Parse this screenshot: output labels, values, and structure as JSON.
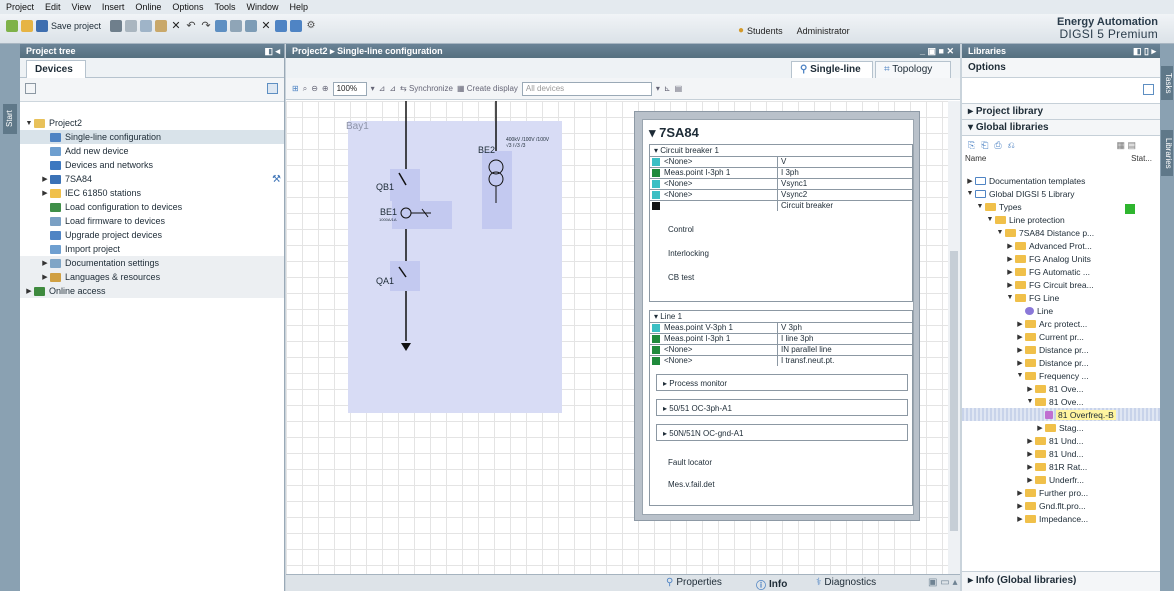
{
  "menu": {
    "items": [
      "Project",
      "Edit",
      "View",
      "Insert",
      "Online",
      "Options",
      "Tools",
      "Window",
      "Help"
    ]
  },
  "toolbar": {
    "save_label": "Save project",
    "user_label": "Students",
    "role_label": "Administrator"
  },
  "brand": {
    "line1": "Energy Automation",
    "line2": "DIGSI 5 Premium"
  },
  "project_tree": {
    "title": "Project tree",
    "tab": "Devices",
    "side_label": "Start",
    "items": [
      {
        "label": "Project2",
        "indent": 0,
        "twisty": "down",
        "icon": "project"
      },
      {
        "label": "Single-line configuration",
        "indent": 1,
        "twisty": "",
        "icon": "sld",
        "selected": true
      },
      {
        "label": "Add new device",
        "indent": 1,
        "twisty": "",
        "icon": "add"
      },
      {
        "label": "Devices and networks",
        "indent": 1,
        "twisty": "",
        "icon": "net"
      },
      {
        "label": "7SA84",
        "indent": 1,
        "twisty": "right",
        "icon": "device"
      },
      {
        "label": "IEC 61850 stations",
        "indent": 1,
        "twisty": "right",
        "icon": "folder"
      },
      {
        "label": "Load configuration to devices",
        "indent": 1,
        "twisty": "",
        "icon": "load"
      },
      {
        "label": "Load firmware to devices",
        "indent": 1,
        "twisty": "",
        "icon": "fw"
      },
      {
        "label": "Upgrade project devices",
        "indent": 1,
        "twisty": "",
        "icon": "upg"
      },
      {
        "label": "Import project",
        "indent": 1,
        "twisty": "",
        "icon": "imp"
      },
      {
        "label": "Documentation settings",
        "indent": 1,
        "twisty": "right",
        "icon": "doc",
        "grey": true
      },
      {
        "label": "Languages & resources",
        "indent": 1,
        "twisty": "right",
        "icon": "lang",
        "grey": true
      },
      {
        "label": "Online access",
        "indent": 0,
        "twisty": "right",
        "icon": "online",
        "grey": true
      }
    ]
  },
  "editor": {
    "breadcrumb": [
      "Project2",
      "Single-line configuration"
    ],
    "tab_singleline": "Single-line",
    "tab_topology": "Topology",
    "zoom": "100%",
    "sync_label": "Synchronize",
    "create_display": "Create display",
    "device_filter": "All devices",
    "bay_label": "Bay1",
    "labels": {
      "be2": "BE2",
      "qb1": "QB1",
      "be1": "BE1",
      "qa1": "QA1",
      "be1_sub": "1000A/1A",
      "be2_rating": "400kV /100V /100V",
      "be2_div": "√3 /√3 /3"
    }
  },
  "popup": {
    "title": "7SA84",
    "cb": {
      "header": "Circuit breaker 1",
      "rows": [
        {
          "color": "#3bbfc4",
          "name": "<None>",
          "value": "V"
        },
        {
          "color": "#1f8a3b",
          "name": "Meas.point I-3ph 1",
          "value": "I 3ph"
        },
        {
          "color": "#3bbfc4",
          "name": "<None>",
          "value": "Vsync1"
        },
        {
          "color": "#3bbfc4",
          "name": "<None>",
          "value": "Vsync2"
        },
        {
          "color": "#111111",
          "name": "",
          "value": "Circuit breaker"
        }
      ],
      "items": [
        "Control",
        "Interlocking",
        "CB test"
      ]
    },
    "line": {
      "header": "Line 1",
      "rows": [
        {
          "color": "#3bbfc4",
          "name": "Meas.point V-3ph 1",
          "value": "V 3ph"
        },
        {
          "color": "#1f8a3b",
          "name": "Meas.point I-3ph 1",
          "value": "I line 3ph"
        },
        {
          "color": "#1f8a3b",
          "name": "<None>",
          "value": "IN parallel line"
        },
        {
          "color": "#1f8a3b",
          "name": "<None>",
          "value": "I transf.neut.pt."
        }
      ],
      "buttons": [
        "Process monitor",
        "50/51 OC-3ph-A1",
        "50N/51N OC-gnd-A1"
      ],
      "items": [
        "Fault locator",
        "Mes.v.fail.det"
      ]
    }
  },
  "bottom_tabs": {
    "properties": "Properties",
    "info": "Info",
    "diagnostics": "Diagnostics"
  },
  "libraries": {
    "title": "Libraries",
    "options": "Options",
    "project_library": "Project library",
    "global_libraries": "Global libraries",
    "col_name": "Name",
    "col_status": "Stat...",
    "info_footer": "Info (Global libraries)",
    "side_tasks": "Tasks",
    "side_libraries": "Libraries",
    "items": [
      {
        "label": "Documentation templates",
        "indent": 0,
        "twisty": "right",
        "icon": "book"
      },
      {
        "label": "Global DIGSI 5 Library",
        "indent": 0,
        "twisty": "down",
        "icon": "book"
      },
      {
        "label": "Types",
        "indent": 1,
        "twisty": "down",
        "icon": "types"
      },
      {
        "label": "Line protection",
        "indent": 2,
        "twisty": "down",
        "icon": "folder"
      },
      {
        "label": "7SA84 Distance p...",
        "indent": 3,
        "twisty": "down",
        "icon": "folder"
      },
      {
        "label": "Advanced Prot...",
        "indent": 4,
        "twisty": "right",
        "icon": "folder"
      },
      {
        "label": "FG Analog Units",
        "indent": 4,
        "twisty": "right",
        "icon": "folder"
      },
      {
        "label": "FG Automatic ...",
        "indent": 4,
        "twisty": "right",
        "icon": "folder"
      },
      {
        "label": "FG Circuit brea...",
        "indent": 4,
        "twisty": "right",
        "icon": "folder"
      },
      {
        "label": "FG Line",
        "indent": 4,
        "twisty": "down",
        "icon": "folder"
      },
      {
        "label": "Line",
        "indent": 5,
        "twisty": "",
        "icon": "line"
      },
      {
        "label": "Arc protect...",
        "indent": 5,
        "twisty": "right",
        "icon": "folder"
      },
      {
        "label": "Current pr...",
        "indent": 5,
        "twisty": "right",
        "icon": "folder"
      },
      {
        "label": "Distance pr...",
        "indent": 5,
        "twisty": "right",
        "icon": "folder"
      },
      {
        "label": "Distance pr...",
        "indent": 5,
        "twisty": "right",
        "icon": "folder"
      },
      {
        "label": "Frequency ...",
        "indent": 5,
        "twisty": "down",
        "icon": "folder"
      },
      {
        "label": "81 Ove...",
        "indent": 6,
        "twisty": "right",
        "icon": "folder"
      },
      {
        "label": "81 Ove...",
        "indent": 6,
        "twisty": "down",
        "icon": "folder"
      },
      {
        "label": "81 Overfreq.-B",
        "indent": 7,
        "twisty": "",
        "icon": "fn",
        "selected": true
      },
      {
        "label": "Stag...",
        "indent": 7,
        "twisty": "right",
        "icon": "folder"
      },
      {
        "label": "81 Und...",
        "indent": 6,
        "twisty": "right",
        "icon": "folder"
      },
      {
        "label": "81 Und...",
        "indent": 6,
        "twisty": "right",
        "icon": "folder"
      },
      {
        "label": "81R Rat...",
        "indent": 6,
        "twisty": "right",
        "icon": "folder"
      },
      {
        "label": "Underfr...",
        "indent": 6,
        "twisty": "right",
        "icon": "folder"
      },
      {
        "label": "Further pro...",
        "indent": 5,
        "twisty": "right",
        "icon": "folder"
      },
      {
        "label": "Gnd.flt.pro...",
        "indent": 5,
        "twisty": "right",
        "icon": "folder"
      },
      {
        "label": "Impedance...",
        "indent": 5,
        "twisty": "right",
        "icon": "folder"
      }
    ]
  },
  "colors": {
    "accent": "#55707f",
    "selected": "#d9e3ea",
    "bay": "#d8dcf5",
    "status_green": "#2fb52f",
    "highlight": "#fff5a0"
  }
}
